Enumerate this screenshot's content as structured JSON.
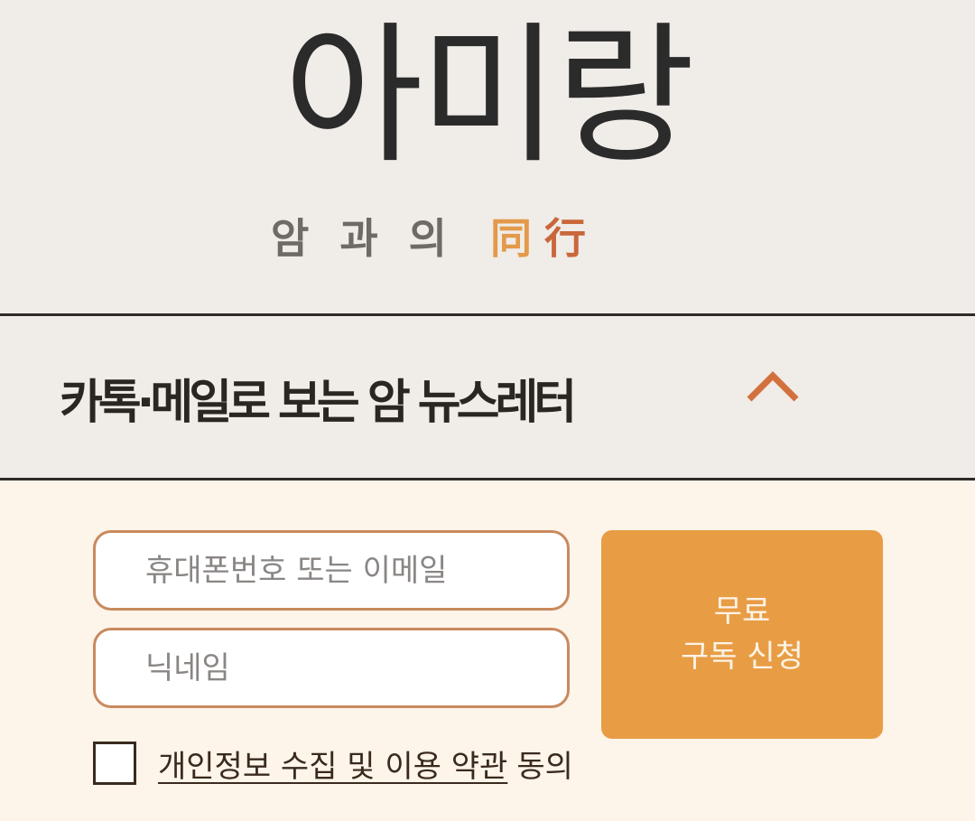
{
  "logo": {
    "main": "아미랑",
    "sub": [
      "암",
      "과",
      "의"
    ],
    "hanja": [
      "同",
      "行"
    ]
  },
  "newsletter": {
    "title": "카톡·메일로 보는 암 뉴스레터",
    "toggle_icon": "chevron-up-icon"
  },
  "form": {
    "contact_placeholder": "휴대폰번호 또는 이메일",
    "nickname_placeholder": "닉네임",
    "submit_line1": "무료",
    "submit_line2": "구독 신청",
    "agree_link": "개인정보 수집 및 이용 약관",
    "agree_suffix": "동의"
  },
  "colors": {
    "header_bg": "#f0ece8",
    "form_bg": "#fdf4ea",
    "accent": "#e89d45",
    "chevron": "#d2713e",
    "hanja_1": "#e39a4a",
    "hanja_2": "#c9673a",
    "field_border": "#c98a5e"
  }
}
